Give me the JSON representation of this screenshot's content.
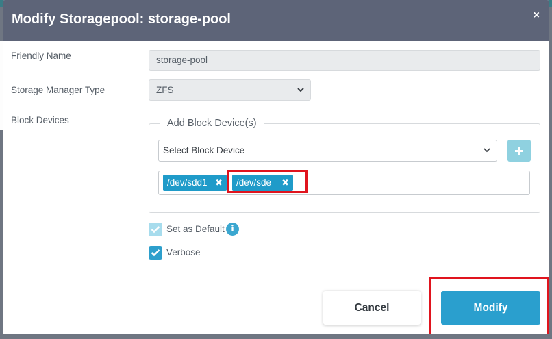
{
  "modal": {
    "title": "Modify Storagepool: storage-pool",
    "close_label": "×"
  },
  "form": {
    "friendly_name": {
      "label": "Friendly Name",
      "value": "storage-pool"
    },
    "storage_manager_type": {
      "label": "Storage Manager Type",
      "value": "ZFS"
    },
    "block_devices": {
      "label": "Block Devices",
      "legend": "Add Block Device(s)",
      "select_placeholder": "Select Block Device",
      "tags": [
        {
          "label": "/dev/sdd1",
          "remove": "✖"
        },
        {
          "label": "/dev/sde",
          "remove": "✖"
        }
      ]
    },
    "set_as_default": {
      "label": "Set as Default",
      "checked": true,
      "disabled": true
    },
    "verbose": {
      "label": "Verbose",
      "checked": true
    }
  },
  "footer": {
    "cancel_label": "Cancel",
    "modify_label": "Modify"
  },
  "icons": {
    "info": "i",
    "plus": "plus-icon",
    "chevron": "chevron-down-icon",
    "check": "checkmark-icon"
  },
  "colors": {
    "header_bg": "#5d6478",
    "accent": "#2a9fce",
    "highlight": "#e0141e"
  }
}
